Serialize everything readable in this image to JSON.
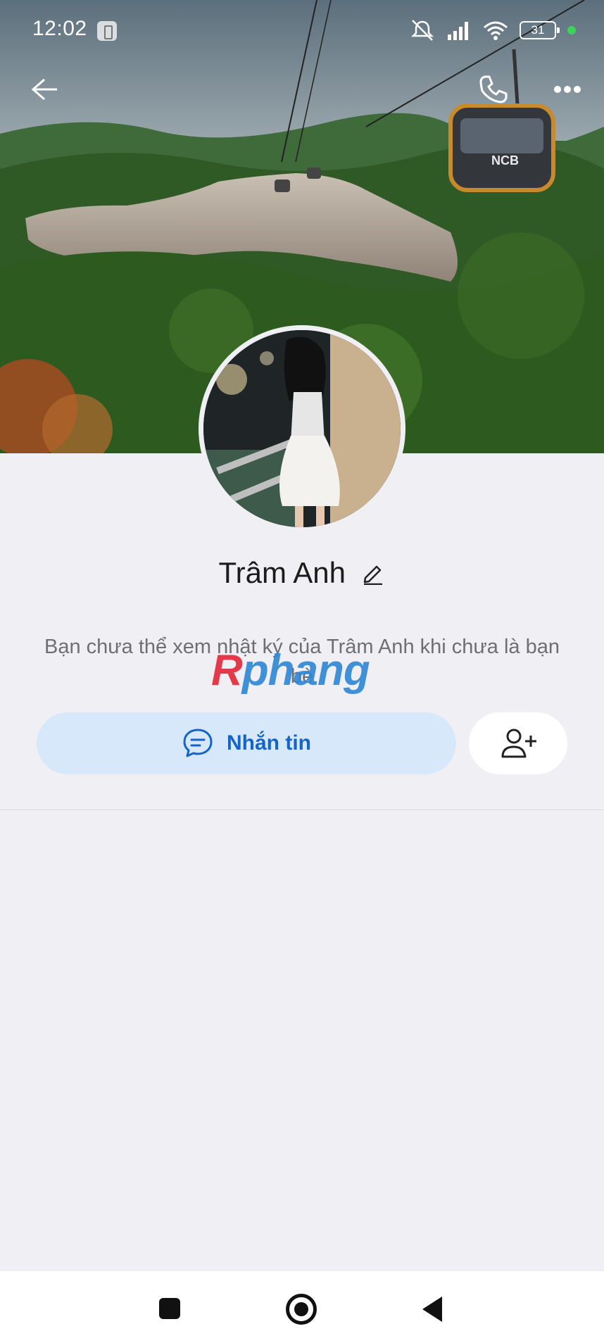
{
  "status_bar": {
    "time": "12:02",
    "battery": "31",
    "icons": [
      "notification-icon",
      "mute-icon",
      "signal-icon",
      "wifi-icon",
      "battery-icon",
      "active-dot-icon"
    ]
  },
  "top_bar": {
    "icons": [
      "back-arrow-icon",
      "phone-icon",
      "more-dots-icon"
    ]
  },
  "profile": {
    "name": "Trâm Anh",
    "note": "Bạn chưa thể xem nhật ký của Trâm Anh khi chưa là bạn bè"
  },
  "watermark": {
    "first": "R",
    "rest": "phang"
  },
  "actions": {
    "message_label": "Nhắn tin",
    "message_icon": "chat-bubble-icon",
    "add_friend_icon": "add-friend-icon"
  },
  "colors": {
    "accent": "#1565c8",
    "message_button_bg": "#d7e8fb",
    "background": "#f0f0f4"
  },
  "nav_bar": {
    "icons": [
      "recent-apps-icon",
      "home-icon",
      "back-icon"
    ]
  }
}
